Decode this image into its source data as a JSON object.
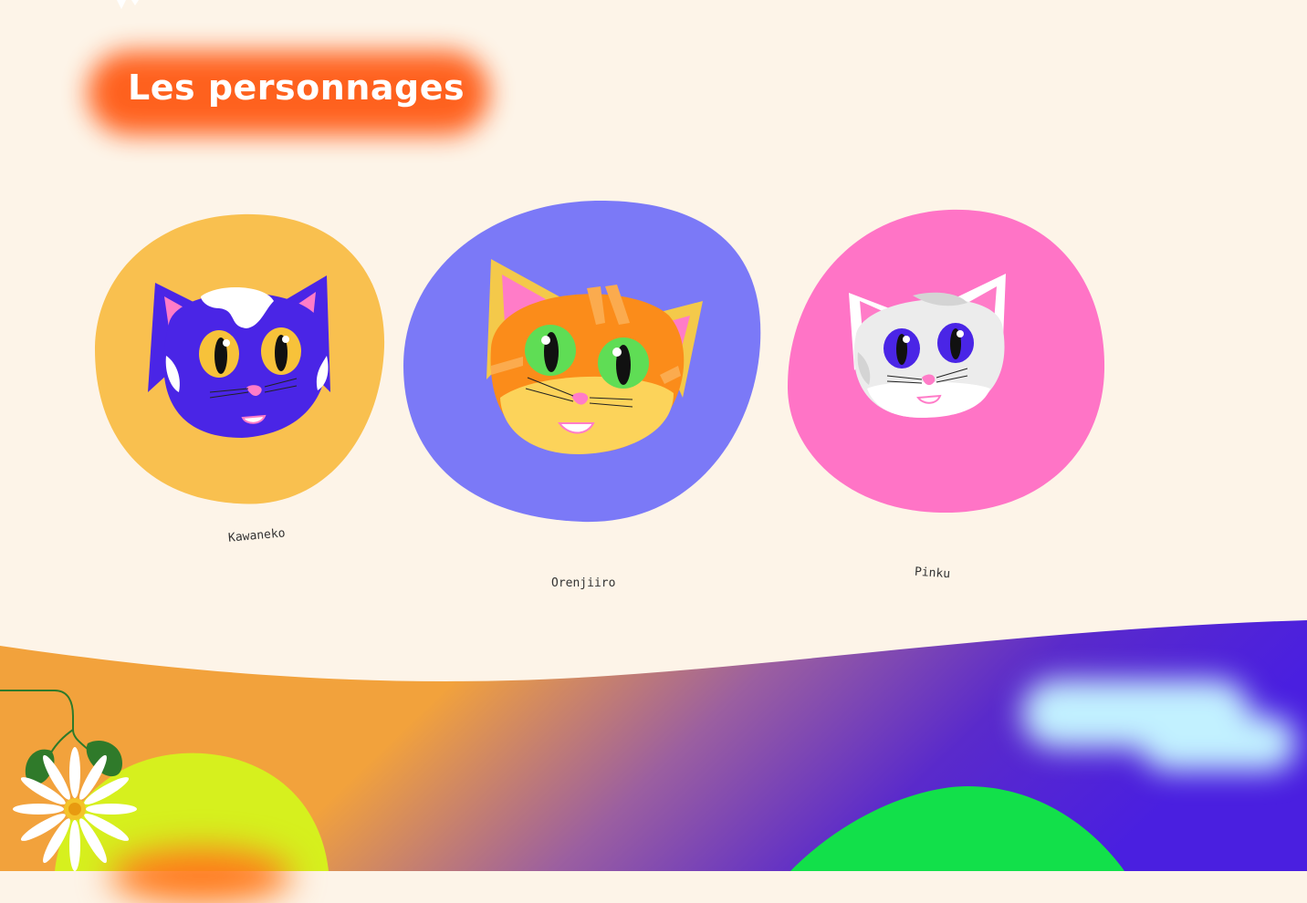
{
  "section": {
    "title": "Les personnages"
  },
  "characters": [
    {
      "name": "Kawaneko",
      "blob_color": "#f9c04f"
    },
    {
      "name": "Orenjiiro",
      "blob_color": "#7b79f7"
    },
    {
      "name": "Pinku",
      "blob_color": "#ff74c6"
    }
  ],
  "colors": {
    "background": "#fdf4e8",
    "title_glow": "#ff5a14",
    "orange": "#f2a23c",
    "purple": "#4a1fe0",
    "hill_green": "#12e04a",
    "hill_lime": "#d6f01e"
  },
  "icons": [
    "star-icon",
    "flower-icon",
    "leaf-icon",
    "cloud-icon"
  ]
}
